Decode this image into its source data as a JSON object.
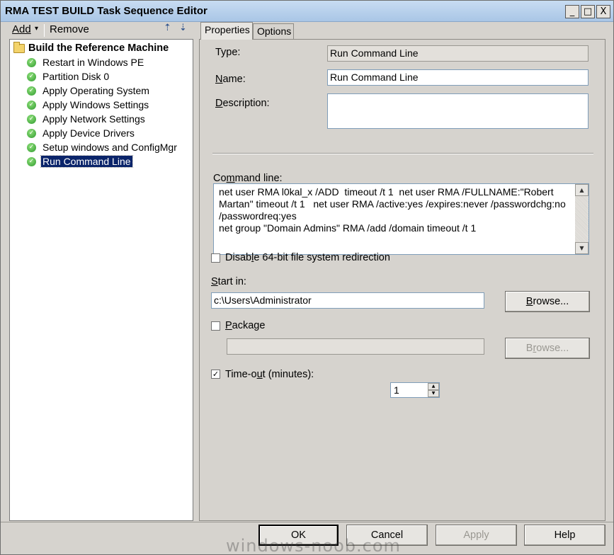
{
  "window": {
    "title": "RMA TEST BUILD Task Sequence Editor"
  },
  "title_buttons": {
    "minimize": "_",
    "maximize": "□",
    "close": "X"
  },
  "toolbar": {
    "add_label": "Add",
    "remove_label": "Remove",
    "dropdown": "▾",
    "move_up": "⇡",
    "move_down": "⇣"
  },
  "tree": {
    "root": "Build the Reference Machine",
    "items": [
      {
        "label": "Restart in Windows PE"
      },
      {
        "label": "Partition Disk 0"
      },
      {
        "label": "Apply Operating System"
      },
      {
        "label": "Apply Windows Settings"
      },
      {
        "label": "Apply Network Settings"
      },
      {
        "label": "Apply Device Drivers"
      },
      {
        "label": "Setup windows and ConfigMgr"
      },
      {
        "label": "Run Command Line",
        "selected": true
      }
    ],
    "status_icon": "green-check-icon"
  },
  "tabs": {
    "properties": "Properties",
    "options": "Options"
  },
  "properties": {
    "type_label": "Type:",
    "type_value": "Run Command Line",
    "name_label": "Name:",
    "name_value": "Run Command Line",
    "description_label": "Description:",
    "description_value": "",
    "command_line_label": "Command line:",
    "command_line_value": "net user RMA l0kal_x /ADD  timeout /t 1  net user RMA /FULLNAME:\"Robert Martan\" timeout /t 1   net user RMA /active:yes /expires:never /passwordchg:no /passwordreq:yes\nnet group \"Domain Admins\" RMA /add /domain timeout /t 1",
    "disable_redirection_label": "Disable 64-bit file system redirection",
    "disable_redirection_checked": false,
    "start_in_label": "Start in:",
    "start_in_value": "c:\\Users\\Administrator",
    "browse_label": "Browse...",
    "package_label": "Package",
    "package_checked": false,
    "package_value": "",
    "package_browse_label": "Browse...",
    "timeout_label": "Time-out (minutes):",
    "timeout_checked": true,
    "timeout_value": "1"
  },
  "buttons": {
    "ok": "OK",
    "cancel": "Cancel",
    "apply": "Apply",
    "help": "Help"
  },
  "watermark": "windows-noob.com",
  "colors": {
    "selection": "#0a246a",
    "titlebar": "#a9c6e6",
    "face": "#d6d3ce"
  }
}
